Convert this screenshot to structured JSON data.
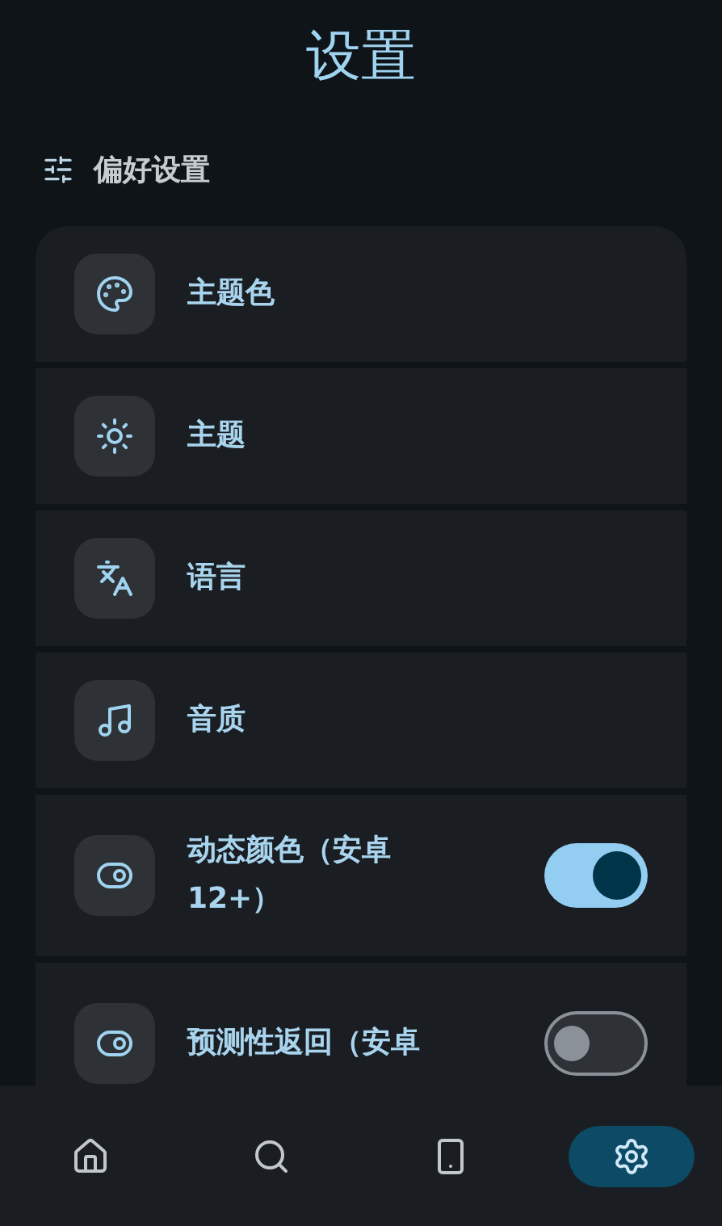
{
  "title": "设置",
  "section": {
    "label": "偏好设置"
  },
  "items": [
    {
      "kind": "link",
      "label": "主题色"
    },
    {
      "kind": "link",
      "label": "主题"
    },
    {
      "kind": "link",
      "label": "语言"
    },
    {
      "kind": "link",
      "label": "音质"
    },
    {
      "kind": "toggle",
      "label": "动态颜色（安卓12+）",
      "on": true
    },
    {
      "kind": "toggle",
      "label": "预测性返回（安卓",
      "on": false
    }
  ],
  "nav": [
    {
      "selected": false
    },
    {
      "selected": false
    },
    {
      "selected": false
    },
    {
      "selected": true
    }
  ]
}
